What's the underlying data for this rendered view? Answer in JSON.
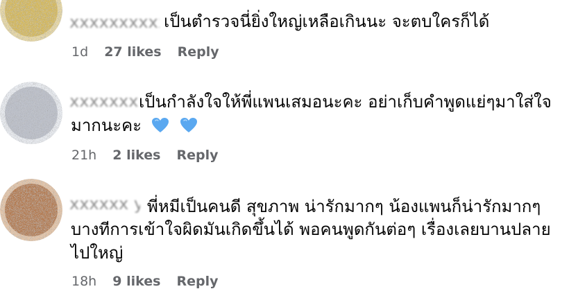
{
  "comments": [
    {
      "author": "xxxxxxxxxx",
      "avatar_color": "#c9a530",
      "text_lines": [
        "เป็นตำรวจนี่ยิ่งใหญ่เหลือเกินนะ จะตบใครก็ได้"
      ],
      "time": "1d",
      "likes": "27 likes",
      "reply": "Reply"
    },
    {
      "author": "xxxxxxxxxx",
      "avatar_color": "#a6adb8",
      "text_lines": [
        "เป็นกำลังใจให้พี่แพนเสมอนะคะ อย่าเก็บคำพูดแย่ๆมาใส่ใจ",
        "มากนะคะ"
      ],
      "hearts": [
        "blue-heart-icon",
        "blue-heart-icon"
      ],
      "time": "21h",
      "likes": "2 likes",
      "reply": "Reply"
    },
    {
      "author": "xxxxxx ya",
      "avatar_color": "#a86a3e",
      "text_lines": [
        "พี่หมีเป็นคนดี สุขภาพ น่ารักมากๆ น้องแพนก็น่ารักมากๆ",
        "บางทีการเข้าใจผิดมันเกิดขึ้นได้ พอคนพูดกันต่อๆ เรื่องเลยบานปลาย",
        "ไปใหญ่"
      ],
      "time": "18h",
      "likes": "9 likes",
      "reply": "Reply"
    }
  ],
  "colors": {
    "text": "#050505",
    "meta": "#65676b",
    "heart": "#5aa8f0"
  }
}
